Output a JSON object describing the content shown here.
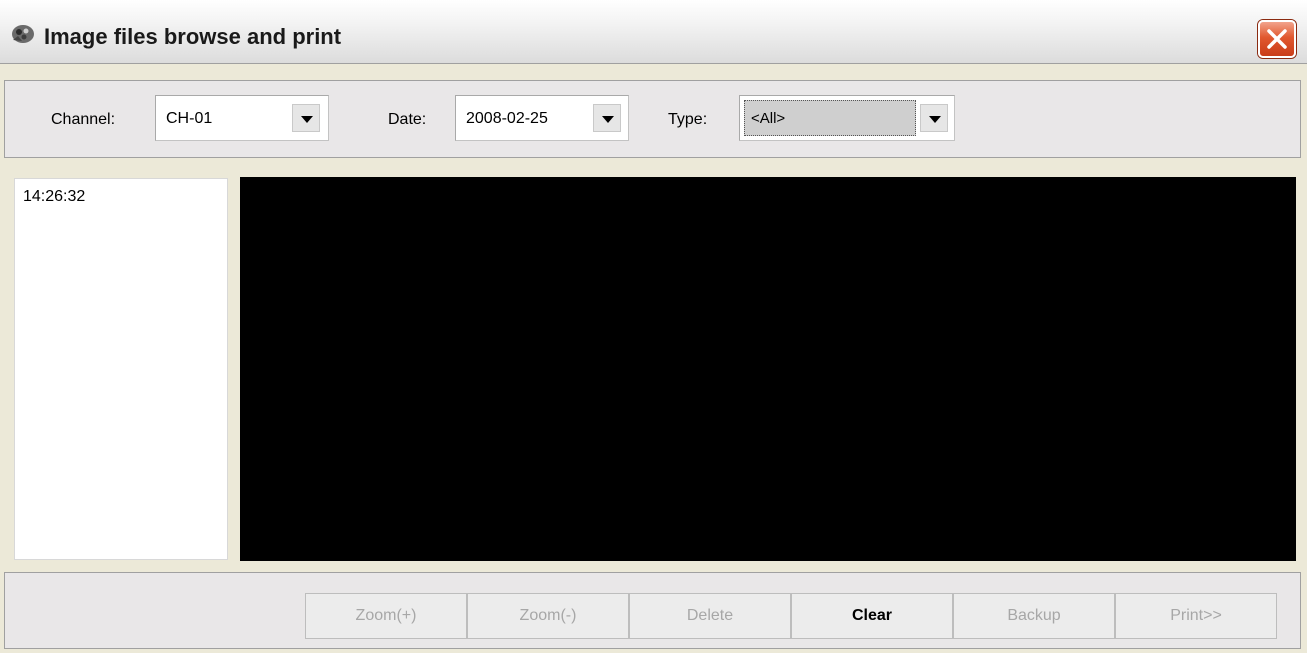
{
  "window": {
    "title": "Image files browse and print"
  },
  "filters": {
    "channel_label": "Channel:",
    "channel_value": "CH-01",
    "date_label": "Date:",
    "date_value": "2008-02-25",
    "type_label": "Type:",
    "type_value": "<All>"
  },
  "file_list": {
    "items": [
      "14:26:32"
    ]
  },
  "buttons": {
    "zoom_in": "Zoom(+)",
    "zoom_out": "Zoom(-)",
    "delete": "Delete",
    "clear": "Clear",
    "backup": "Backup",
    "print": "Print>>"
  },
  "icons": {
    "title": "camera-grip-icon",
    "close": "close-icon",
    "dropdown": "chevron-down-icon"
  },
  "colors": {
    "close_button": "#e1582f",
    "preview_background": "#000000",
    "disabled_text": "#a7a7a7"
  }
}
